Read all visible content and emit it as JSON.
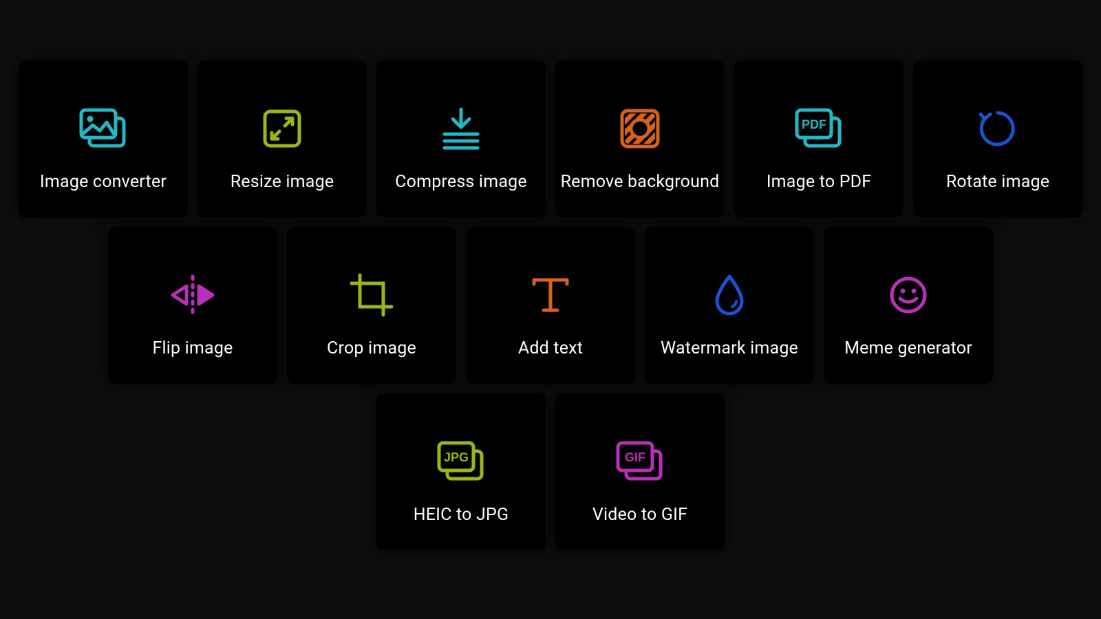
{
  "colors": {
    "cyan": "#23b8c5",
    "olive": "#9eb417",
    "orange": "#d6631d",
    "blue": "#1b52d4",
    "purple": "#b82fb8"
  },
  "tools": {
    "image_converter": {
      "label": "Image converter",
      "icon": "image-stack",
      "color": "cyan"
    },
    "resize_image": {
      "label": "Resize image",
      "icon": "resize",
      "color": "olive"
    },
    "compress_image": {
      "label": "Compress image",
      "icon": "compress",
      "color": "cyan"
    },
    "remove_bg": {
      "label": "Remove background",
      "icon": "remove-bg",
      "color": "orange"
    },
    "image_to_pdf": {
      "label": "Image to PDF",
      "icon": "pdf-stack",
      "color": "cyan"
    },
    "rotate_image": {
      "label": "Rotate image",
      "icon": "rotate",
      "color": "blue"
    },
    "flip_image": {
      "label": "Flip image",
      "icon": "flip",
      "color": "purple"
    },
    "crop_image": {
      "label": "Crop image",
      "icon": "crop",
      "color": "olive"
    },
    "add_text": {
      "label": "Add text",
      "icon": "text",
      "color": "orange"
    },
    "watermark": {
      "label": "Watermark image",
      "icon": "watermark",
      "color": "blue"
    },
    "meme": {
      "label": "Meme generator",
      "icon": "smiley",
      "color": "purple"
    },
    "heic_to_jpg": {
      "label": "HEIC to JPG",
      "icon": "jpg-stack",
      "color": "olive"
    },
    "video_to_gif": {
      "label": "Video to GIF",
      "icon": "gif-stack",
      "color": "purple"
    }
  },
  "rows": [
    [
      "image_converter",
      "resize_image",
      "compress_image",
      "remove_bg",
      "image_to_pdf",
      "rotate_image"
    ],
    [
      "flip_image",
      "crop_image",
      "add_text",
      "watermark",
      "meme"
    ],
    [
      "heic_to_jpg",
      "video_to_gif"
    ]
  ]
}
